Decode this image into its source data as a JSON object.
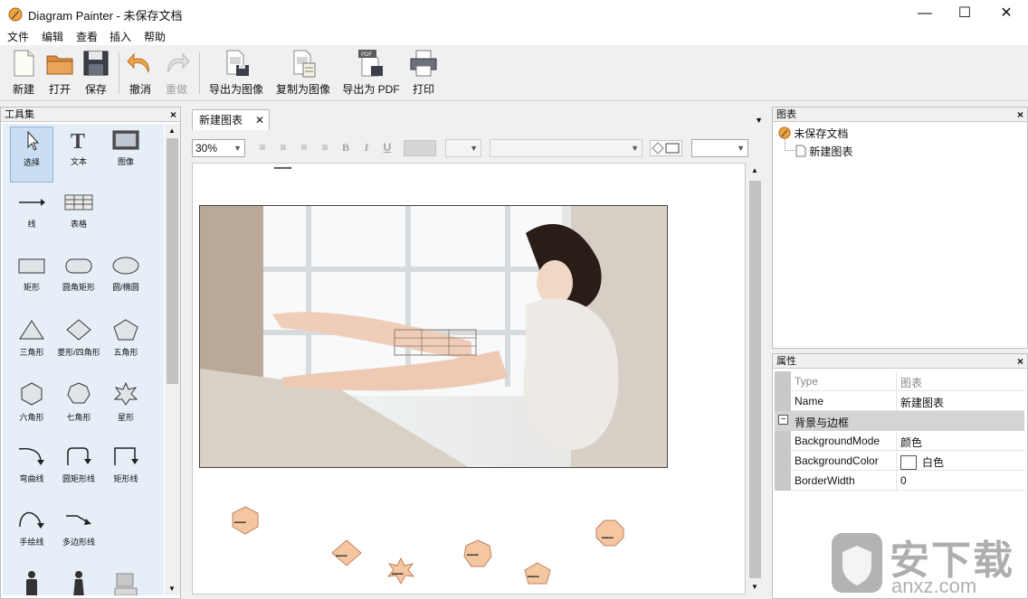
{
  "window": {
    "title": "Diagram Painter - 未保存文档",
    "minimize": "—",
    "maximize": "☐",
    "close": "✕"
  },
  "menu": [
    "文件",
    "编辑",
    "查看",
    "插入",
    "帮助"
  ],
  "toolbar": {
    "new": "新建",
    "open": "打开",
    "save": "保存",
    "undo": "撤消",
    "redo": "重做",
    "export_image": "导出为图像",
    "copy_image": "复制为图像",
    "export_pdf": "导出为 PDF",
    "print": "打印"
  },
  "toolbox": {
    "title": "工具集",
    "tools": [
      "选择",
      "文本",
      "图像",
      "线",
      "表格",
      "矩形",
      "圆角矩形",
      "圆/椭圆",
      "三角形",
      "菱形/四角形",
      "五角形",
      "六角形",
      "七角形",
      "星形",
      "弯曲线",
      "圆矩形线",
      "矩形线",
      "手绘线",
      "多边形线"
    ]
  },
  "editor": {
    "tab": "新建图表",
    "zoom": "30%",
    "canvas_note": "■■■■■■■■",
    "shape_label": "■■■■■■■"
  },
  "diagram_panel": {
    "title": "图表",
    "root": "未保存文档",
    "child": "新建图表"
  },
  "properties": {
    "title": "属性",
    "type_key": "Type",
    "type_val": "图表",
    "name_key": "Name",
    "name_val": "新建图表",
    "group": "背景与边框",
    "mode_key": "BackgroundMode",
    "mode_val": "颜色",
    "color_key": "BackgroundColor",
    "color_val": "白色",
    "width_key": "BorderWidth",
    "width_val": "0"
  },
  "watermark": {
    "brand": "安下载",
    "site": "anxz.com"
  },
  "colors": {
    "shape_fill": "#f4c7a1",
    "shape_stroke": "#c08060",
    "toolbox_bg": "#e6eef8",
    "selection": "#c9ddf3"
  }
}
